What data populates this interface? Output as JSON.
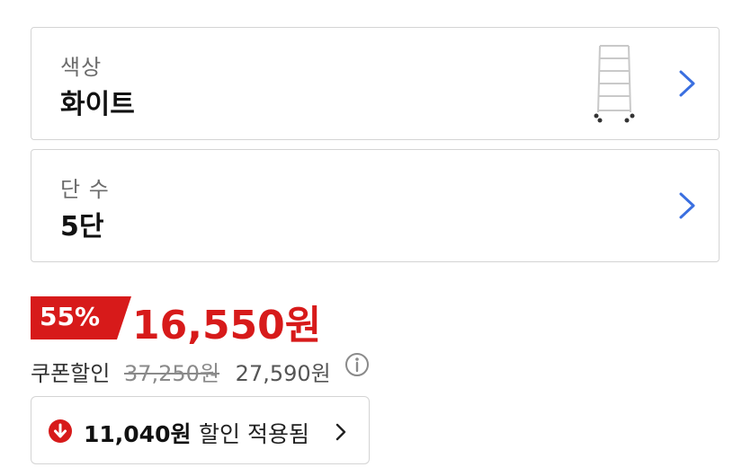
{
  "options": {
    "color": {
      "label": "색상",
      "value": "화이트"
    },
    "tiers": {
      "label": "단 수",
      "value": "5단"
    }
  },
  "price": {
    "discount_rate": "55%",
    "sale_price": "16,550원",
    "coupon_label": "쿠폰할인",
    "original_price": "37,250원",
    "before_coupon_price": "27,590원"
  },
  "discount_button": {
    "amount": "11,040원",
    "text": "할인 적용됨"
  },
  "colors": {
    "accent_red": "#d71a1a",
    "chevron_blue": "#3a6fe0",
    "border": "#d4d4d4"
  },
  "icons": [
    "product-thumbnail",
    "chevron-right-icon",
    "info-icon",
    "down-arrow-icon"
  ]
}
